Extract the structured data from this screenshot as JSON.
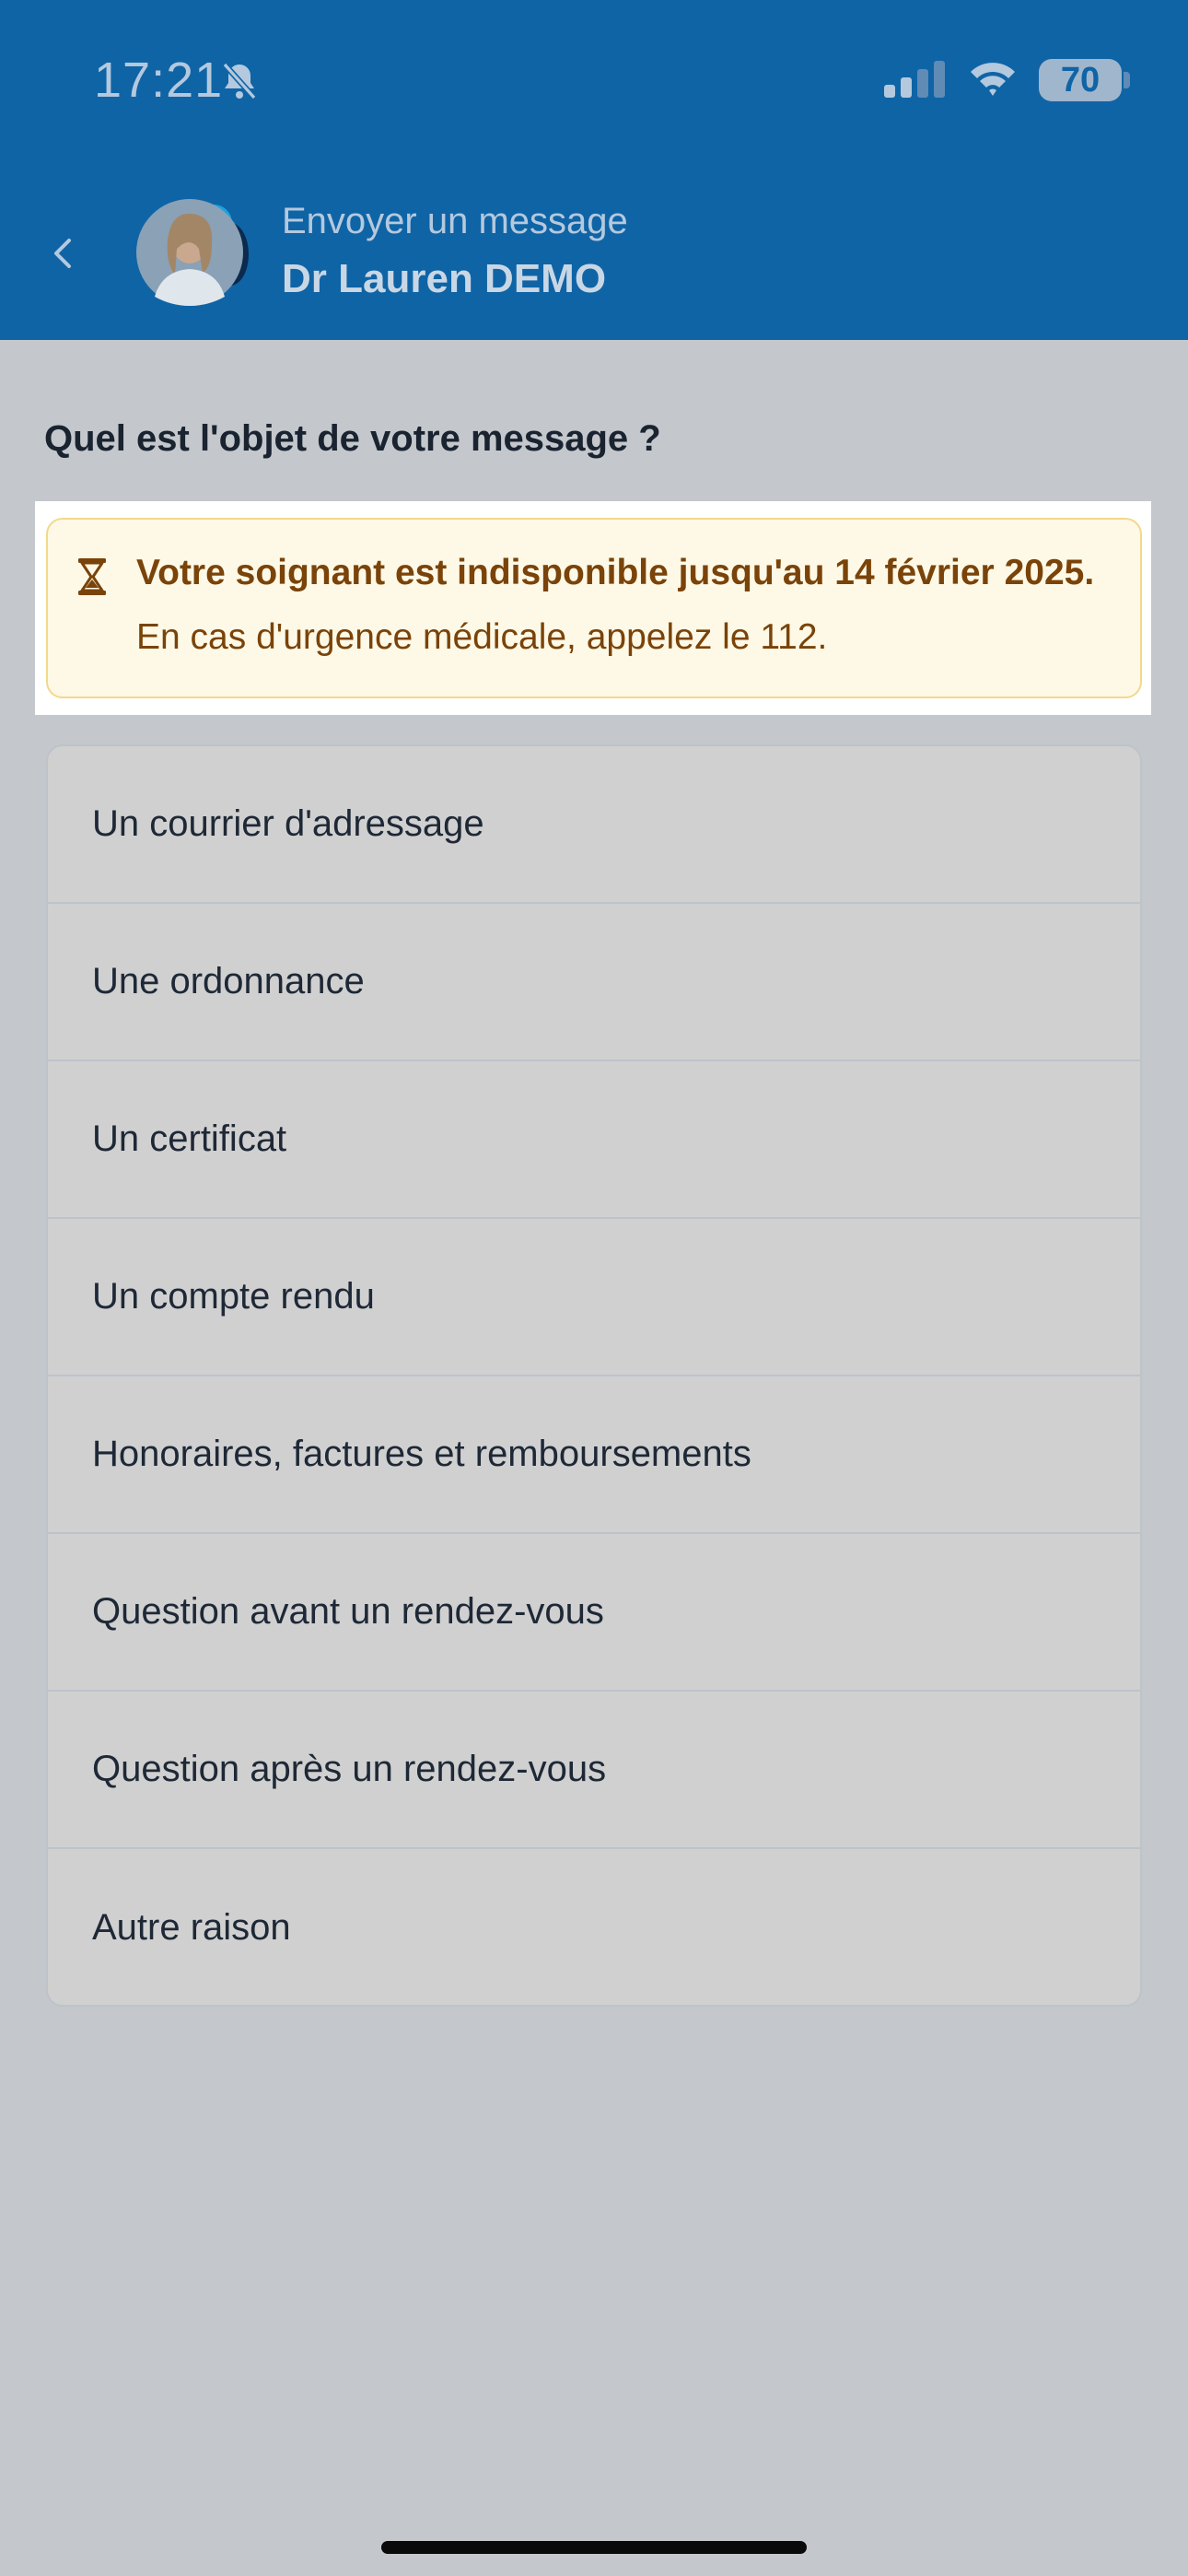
{
  "status_bar": {
    "time": "17:21",
    "battery": "70",
    "icons": [
      "bell-slash-icon",
      "signal-icon",
      "wifi-icon",
      "battery-icon"
    ]
  },
  "header": {
    "subtitle": "Envoyer un message",
    "title": "Dr Lauren DEMO",
    "back_icon": "chevron-left-icon"
  },
  "question": "Quel est l'objet de votre message ?",
  "notice": {
    "icon": "hourglass-icon",
    "title": "Votre soignant est indisponible jusqu'au 14 février 2025.",
    "body": "En cas d'urgence médicale, appelez le 112."
  },
  "options": [
    {
      "label": "Un courrier d'adressage"
    },
    {
      "label": "Une ordonnance"
    },
    {
      "label": "Un certificat"
    },
    {
      "label": "Un compte rendu"
    },
    {
      "label": "Honoraires, factures et remboursements"
    },
    {
      "label": "Question avant un rendez-vous"
    },
    {
      "label": "Question après un rendez-vous"
    },
    {
      "label": "Autre raison"
    }
  ],
  "colors": {
    "header_bg": "#0f64a6",
    "page_bg": "#c4c8cc",
    "notice_bg": "#fef9e6",
    "notice_text": "#7a4309"
  }
}
